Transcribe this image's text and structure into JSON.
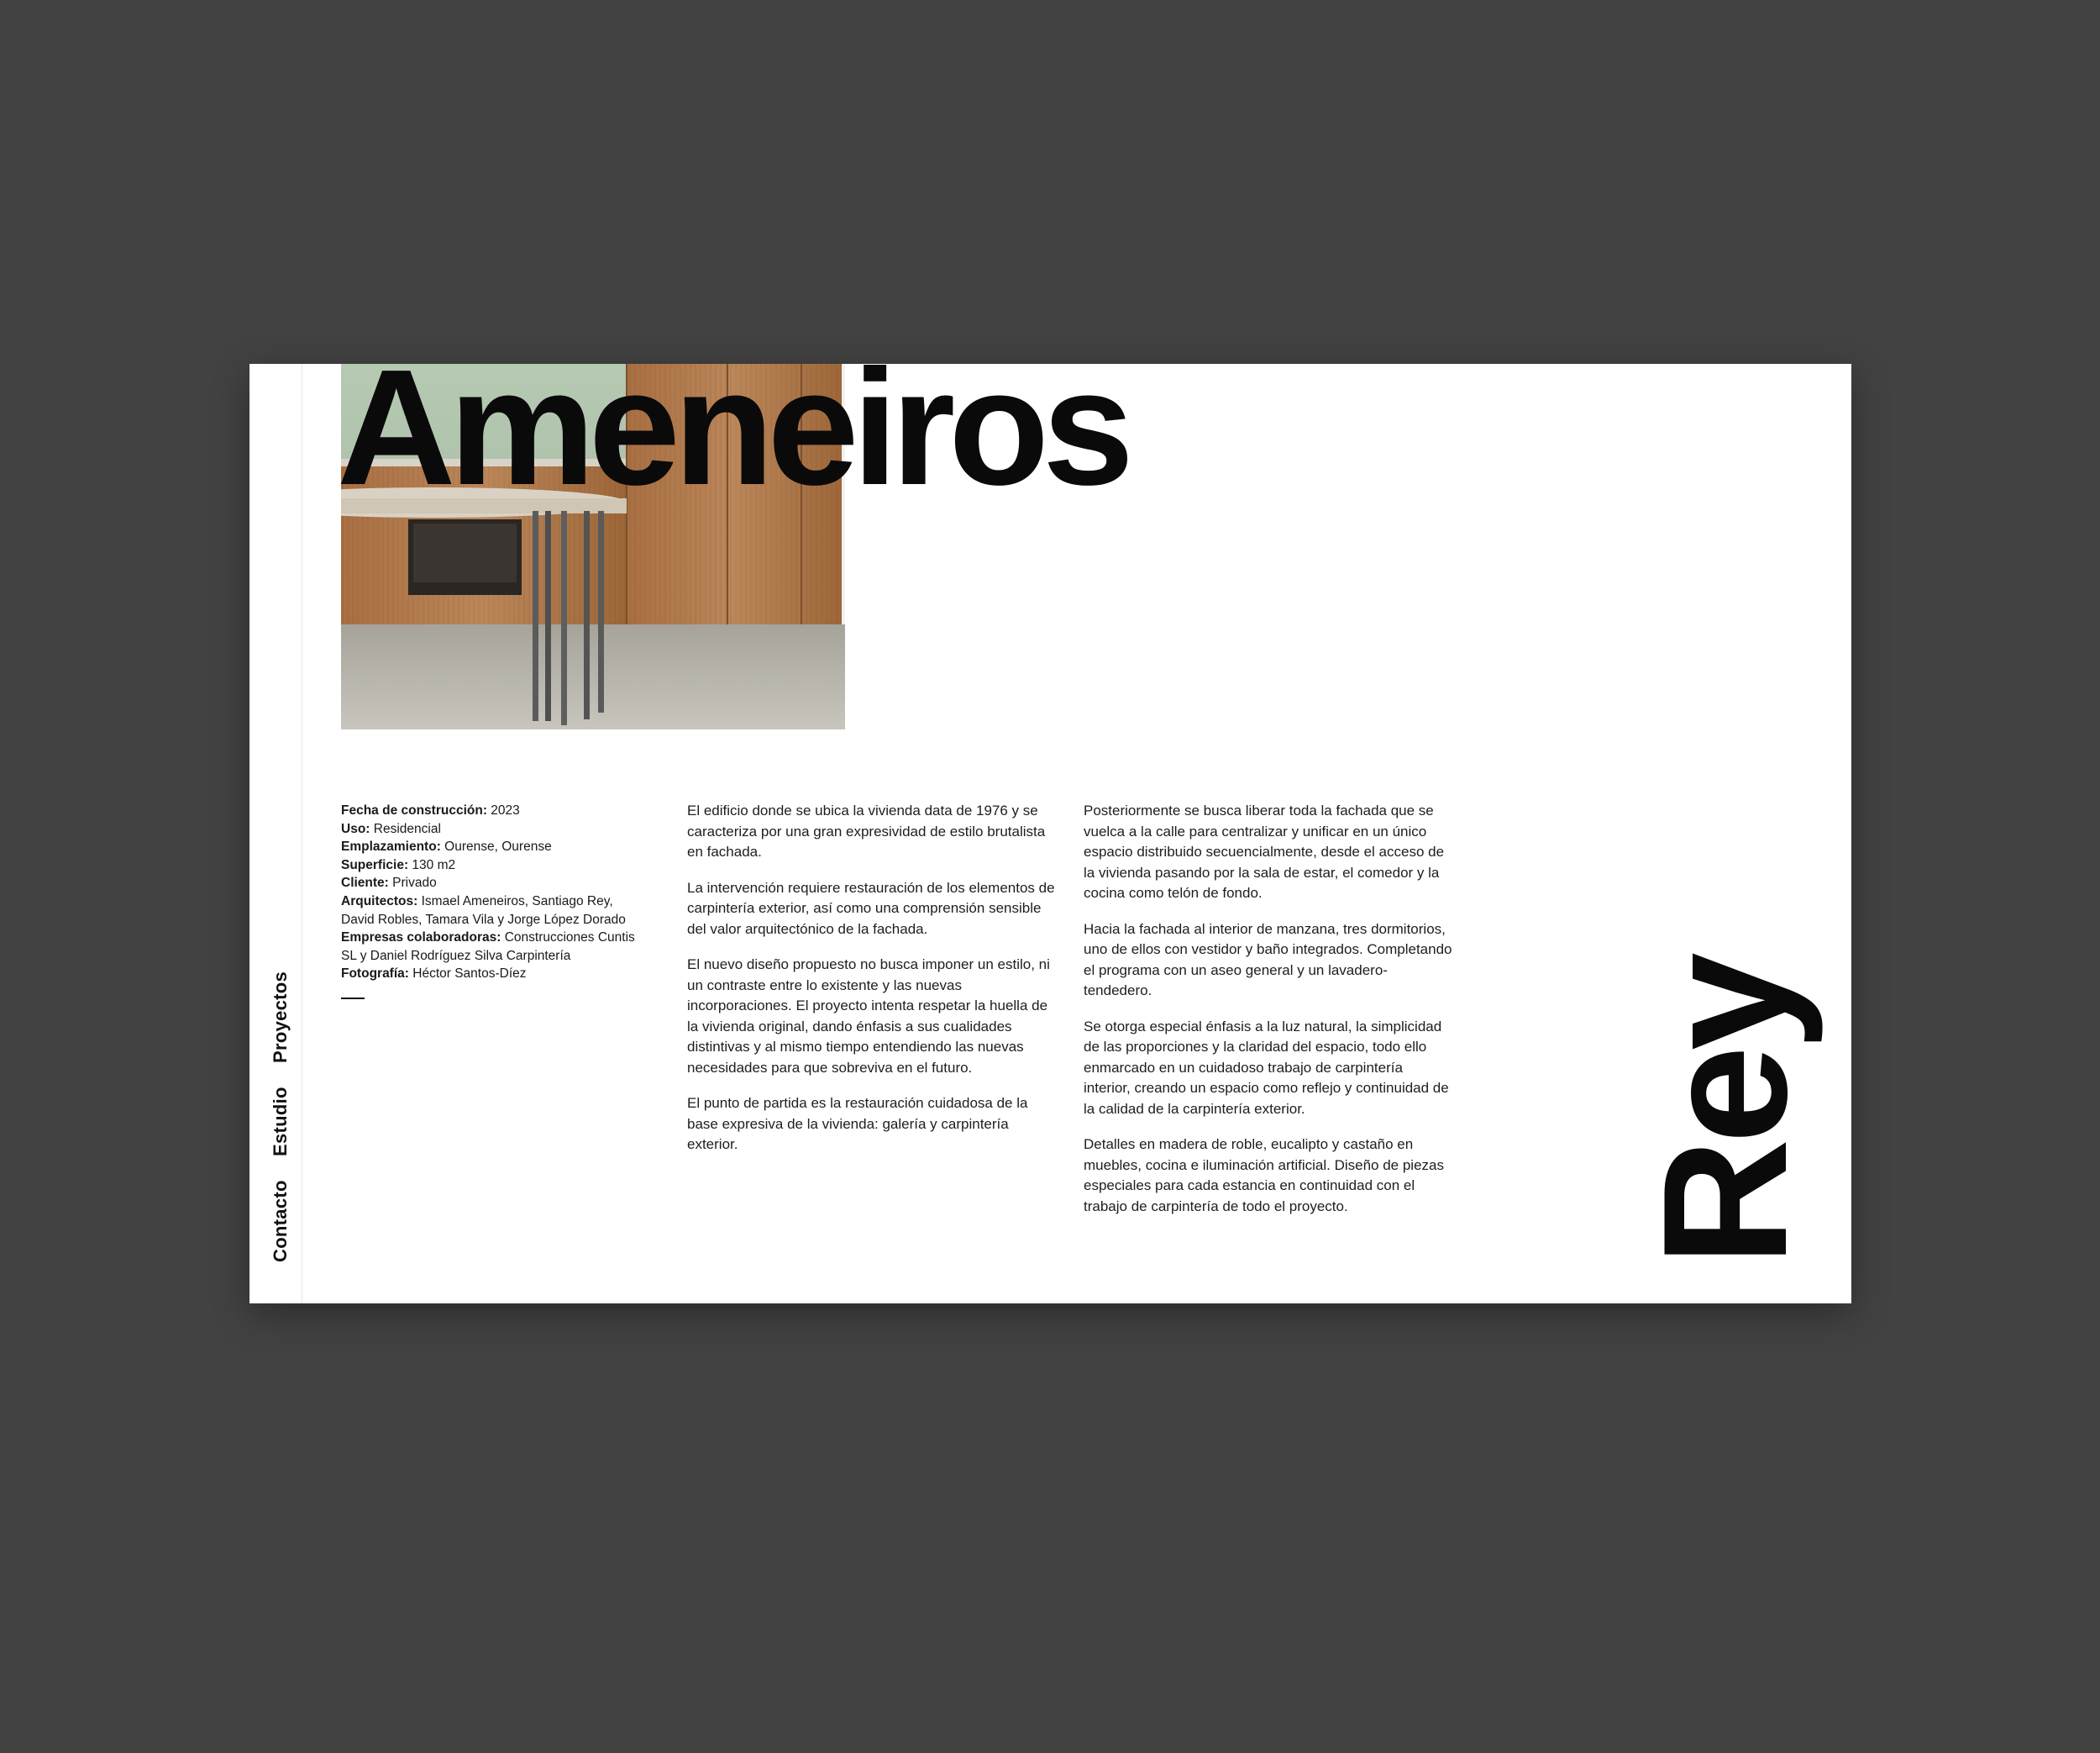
{
  "nav": {
    "proyectos": "Proyectos",
    "estudio": "Estudio",
    "contacto": "Contacto"
  },
  "project": {
    "title": "Ameneiros",
    "subtitle": "Rey"
  },
  "meta": [
    {
      "label": "Fecha de construcción:",
      "value": "2023"
    },
    {
      "label": "Uso:",
      "value": "Residencial"
    },
    {
      "label": "Emplazamiento:",
      "value": "Ourense, Ourense"
    },
    {
      "label": "Superficie:",
      "value": "130 m2"
    },
    {
      "label": "Cliente:",
      "value": "Privado"
    },
    {
      "label": "Arquitectos:",
      "value": "Ismael Ameneiros, Santiago Rey, David Robles, Tamara Vila y Jorge López Dorado"
    },
    {
      "label": "Empresas colaboradoras:",
      "value": "Construcciones Cuntis SL y Daniel Rodríguez Silva Carpintería"
    },
    {
      "label": "Fotografía:",
      "value": "Héctor Santos-Díez"
    }
  ],
  "column_a": [
    "El edificio donde se ubica la vivienda data de 1976 y se caracteriza por una gran expresividad de estilo brutalista en fachada.",
    "La intervención requiere restauración de los elementos de carpintería exterior, así como una comprensión sensible del valor arquitectónico de la fachada.",
    "El nuevo diseño propuesto no busca imponer un estilo, ni un contraste entre lo existente y las nuevas incorporaciones. El proyecto intenta respetar la huella de la vivienda original, dando énfasis a sus cualidades distintivas y al mismo tiempo entendiendo las nuevas necesidades para que sobreviva en el futuro.",
    "El punto de partida es la restauración cuidadosa de la base expresiva de la vivienda: galería y carpintería exterior."
  ],
  "column_b": [
    "Posteriormente se busca liberar toda la fachada que se vuelca a la calle para centralizar y unificar en un único espacio distribuido secuencialmente, desde el acceso de la vivienda pasando por la sala de estar, el comedor y la cocina como telón de fondo.",
    "Hacia la fachada al interior de manzana, tres dormitorios, uno de ellos con vestidor y baño integrados. Completando el programa con un aseo general y un lavadero-tendedero.",
    "Se otorga especial énfasis a la luz natural, la simplicidad de las proporciones y la claridad del espacio, todo ello enmarcado en un cuidadoso trabajo de carpintería interior, creando un espacio como reflejo y continuidad de la calidad de la carpintería exterior.",
    "Detalles en madera de roble, eucalipto y castaño en muebles, cocina e iluminación artificial. Diseño de piezas especiales para cada estancia en continuidad con el trabajo de carpintería de todo el proyecto."
  ],
  "colors": {
    "background": "#424242",
    "page": "#ffffff",
    "text": "#111111",
    "wood": "#b07a4c",
    "wall_green": "#a9bfa8",
    "floor": "#b9b5ac"
  }
}
